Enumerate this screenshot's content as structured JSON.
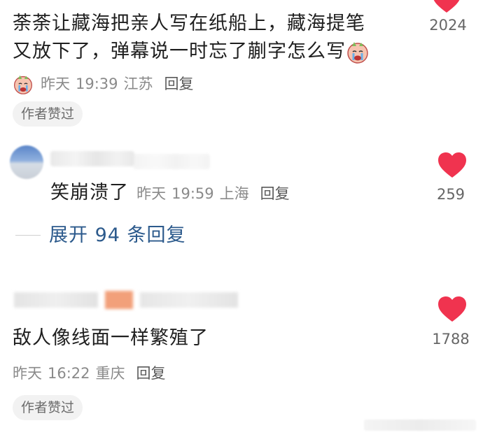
{
  "comment1": {
    "text_line1": "荼荼让藏海把亲人写在纸船上，藏海提笔",
    "text_line2": "又放下了，弹幕说一时忘了蒯字怎么写",
    "date": "昨天",
    "time": "19:39",
    "location": "江苏",
    "reply_label": "回复",
    "like_count": "2024",
    "author_chip": "作者赞过"
  },
  "comment2": {
    "text": "笑崩溃了",
    "date": "昨天",
    "time": "19:59",
    "location": "上海",
    "reply_label": "回复",
    "like_count": "259",
    "expand_label": "展开 94 条回复"
  },
  "comment3": {
    "text": "敌人像线面一样繁殖了",
    "date": "昨天",
    "time": "16:22",
    "location": "重庆",
    "reply_label": "回复",
    "like_count": "1788",
    "author_chip": "作者赞过"
  },
  "colors": {
    "heart": "#f0334f",
    "link": "#2c5a8c",
    "meta": "#8a8a8a"
  },
  "icons": {
    "like": "heart-icon",
    "emoji": "crying-emoji-icon"
  }
}
